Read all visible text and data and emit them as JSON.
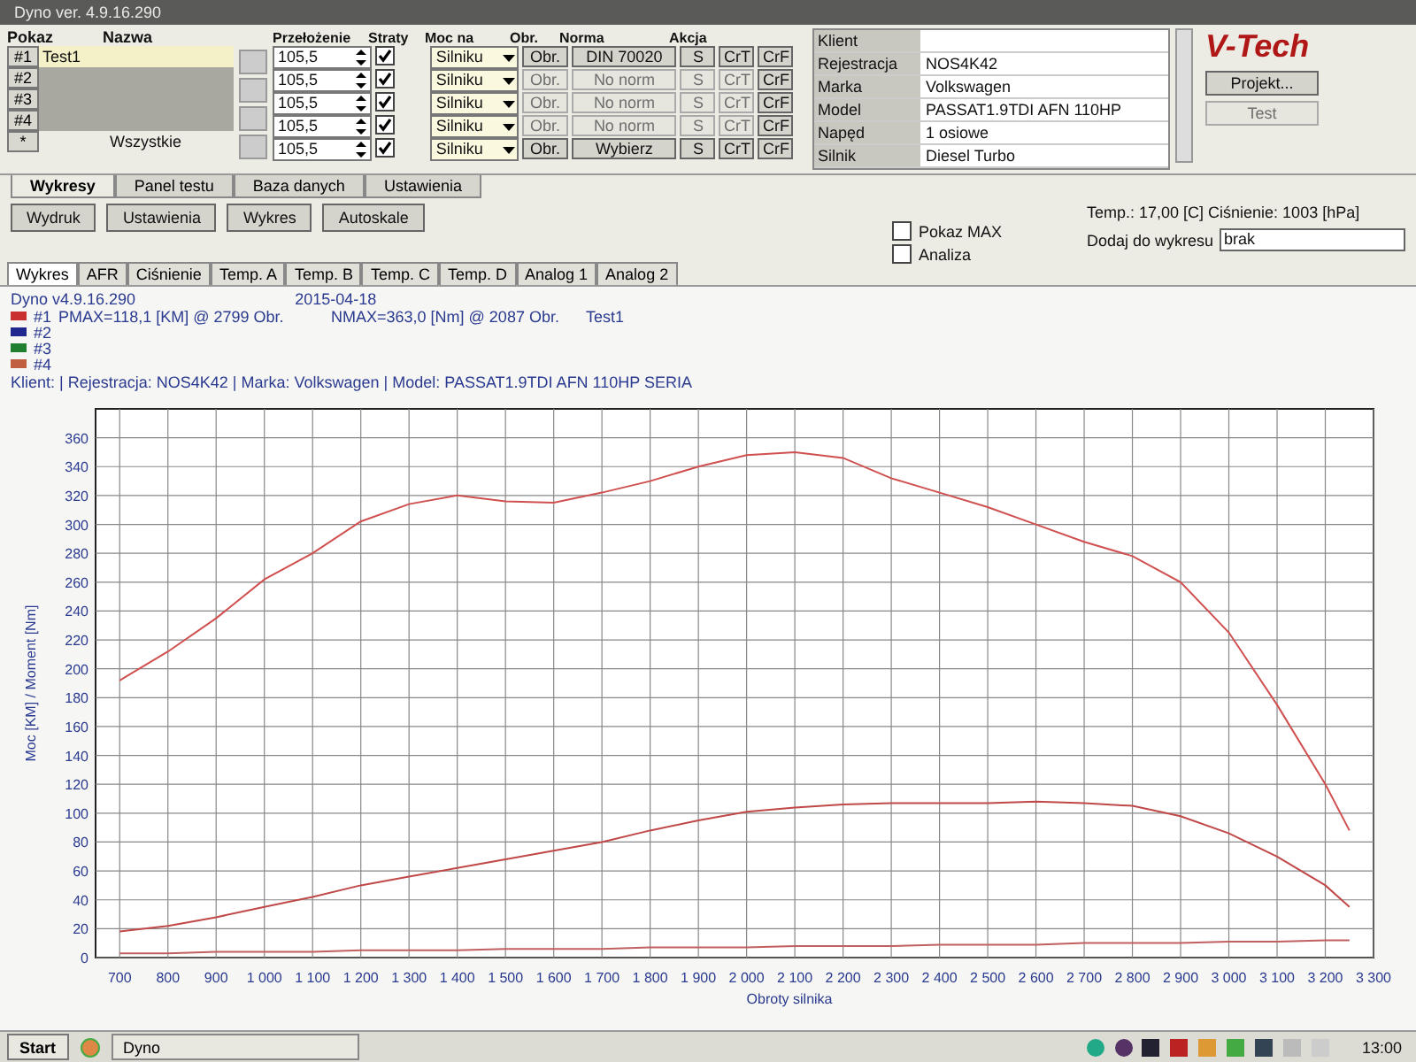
{
  "window": {
    "title": "Dyno ver. 4.9.16.290"
  },
  "tests": {
    "headers": [
      "Pokaz",
      "Nazwa"
    ],
    "rows": [
      {
        "label": "#1",
        "name": "Test1",
        "selected": true
      },
      {
        "label": "#2",
        "selected": false
      },
      {
        "label": "#3",
        "selected": false
      },
      {
        "label": "#4",
        "selected": false
      }
    ],
    "all_button": "*",
    "all_label": "Wszystkie"
  },
  "settings": {
    "headers": [
      "Przełożenie",
      "Straty",
      "Moc na",
      "Obr.",
      "Norma",
      "Akcja"
    ],
    "rows": [
      {
        "ratio": "105,5",
        "losses": true,
        "power_at": "Silniku",
        "rpm_button": "Obr.",
        "rpm_enabled": true,
        "norm": "DIN 70020",
        "norm_enabled": true,
        "actions": [
          {
            "label": "S",
            "enabled": true
          },
          {
            "label": "CrT",
            "enabled": true
          },
          {
            "label": "CrF",
            "enabled": true
          }
        ]
      },
      {
        "ratio": "105,5",
        "losses": true,
        "power_at": "Silniku",
        "rpm_button": "Obr.",
        "rpm_enabled": false,
        "norm": "No norm",
        "norm_enabled": false,
        "actions": [
          {
            "label": "S",
            "enabled": false
          },
          {
            "label": "CrT",
            "enabled": false
          },
          {
            "label": "CrF",
            "enabled": true
          }
        ]
      },
      {
        "ratio": "105,5",
        "losses": true,
        "power_at": "Silniku",
        "rpm_button": "Obr.",
        "rpm_enabled": false,
        "norm": "No norm",
        "norm_enabled": false,
        "actions": [
          {
            "label": "S",
            "enabled": false
          },
          {
            "label": "CrT",
            "enabled": false
          },
          {
            "label": "CrF",
            "enabled": true
          }
        ]
      },
      {
        "ratio": "105,5",
        "losses": true,
        "power_at": "Silniku",
        "rpm_button": "Obr.",
        "rpm_enabled": false,
        "norm": "No norm",
        "norm_enabled": false,
        "actions": [
          {
            "label": "S",
            "enabled": false
          },
          {
            "label": "CrT",
            "enabled": false
          },
          {
            "label": "CrF",
            "enabled": true
          }
        ]
      },
      {
        "ratio": "105,5",
        "losses": true,
        "power_at": "Silniku",
        "rpm_button": "Obr.",
        "rpm_enabled": true,
        "norm": "Wybierz",
        "norm_enabled": true,
        "actions": [
          {
            "label": "S",
            "enabled": true
          },
          {
            "label": "CrT",
            "enabled": true
          },
          {
            "label": "CrF",
            "enabled": true
          }
        ]
      }
    ]
  },
  "client": [
    {
      "label": "Klient"
    },
    {
      "label": "Rejestracja",
      "value": "NOS4K42"
    },
    {
      "label": "Marka",
      "value": "Volkswagen"
    },
    {
      "label": "Model",
      "value": "PASSAT1.9TDI AFN 110HP"
    },
    {
      "label": "Napęd",
      "value": "1 osiowe"
    },
    {
      "label": "Silnik",
      "value": "Diesel Turbo"
    }
  ],
  "logo": "V-Tech",
  "side_buttons": [
    {
      "label": "Projekt...",
      "enabled": true
    },
    {
      "label": "Test",
      "enabled": false
    }
  ],
  "main_tabs": [
    {
      "label": "Wykresy",
      "selected": true
    },
    {
      "label": "Panel testu",
      "selected": false
    },
    {
      "label": "Baza danych",
      "selected": false
    },
    {
      "label": "Ustawienia",
      "selected": false
    }
  ],
  "toolbar": [
    "Wydruk",
    "Ustawienia",
    "Wykres",
    "Autoskale"
  ],
  "conditions": "Temp.: 17,00 [C]  Ciśnienie: 1003 [hPa]",
  "options": [
    {
      "label": "Pokaz MAX",
      "checked": false
    },
    {
      "label": "Analiza",
      "checked": false
    }
  ],
  "add_to_chart": {
    "label": "Dodaj do wykresu",
    "value": "brak"
  },
  "chart_tabs": [
    {
      "label": "Wykres",
      "selected": true
    },
    {
      "label": "AFR",
      "selected": false
    },
    {
      "label": "Ciśnienie",
      "selected": false
    },
    {
      "label": "Temp. A",
      "selected": false
    },
    {
      "label": "Temp. B",
      "selected": false
    },
    {
      "label": "Temp. C",
      "selected": false
    },
    {
      "label": "Temp. D",
      "selected": false
    },
    {
      "label": "Analog 1",
      "selected": false
    },
    {
      "label": "Analog 2",
      "selected": false
    }
  ],
  "chart_header": {
    "version": "Dyno v4.9.16.290",
    "date": "2015-04-18",
    "legend": [
      {
        "label": "#1",
        "color": "#c83030",
        "pmax": "PMAX=118,1 [KM] @ 2799 Obr.",
        "nmax": "NMAX=363,0 [Nm] @ 2087 Obr.",
        "test": "Test1"
      },
      {
        "label": "#2",
        "color": "#202890"
      },
      {
        "label": "#3",
        "color": "#208030"
      },
      {
        "label": "#4",
        "color": "#c06040"
      }
    ],
    "client_line": "Klient:  | Rejestracja: NOS4K42 | Marka: Volkswagen | Model: PASSAT1.9TDI AFN 110HP SERIA"
  },
  "chart_data": {
    "type": "line",
    "xlabel": "Obroty silnika",
    "ylabel": "Moc [KM] / Moment [Nm]",
    "x": [
      700,
      800,
      900,
      1000,
      1100,
      1200,
      1300,
      1400,
      1500,
      1600,
      1700,
      1800,
      1900,
      2000,
      2100,
      2200,
      2300,
      2400,
      2500,
      2600,
      2700,
      2800,
      2900,
      3000,
      3100,
      3200,
      3250
    ],
    "grid": true,
    "series": [
      {
        "color": "#d05050",
        "values": [
          192,
          212,
          235,
          262,
          280,
          302,
          314,
          320,
          316,
          315,
          322,
          330,
          340,
          348,
          350,
          346,
          332,
          322,
          312,
          300,
          288,
          278,
          260,
          225,
          175,
          120,
          88
        ]
      },
      {
        "color": "#c04848",
        "values": [
          18,
          22,
          28,
          35,
          42,
          50,
          56,
          62,
          68,
          74,
          80,
          88,
          95,
          101,
          104,
          106,
          107,
          107,
          107,
          108,
          107,
          105,
          98,
          86,
          70,
          50,
          35
        ]
      },
      {
        "color": "#c06060",
        "values": [
          3,
          3,
          4,
          4,
          4,
          5,
          5,
          5,
          6,
          6,
          6,
          7,
          7,
          7,
          8,
          8,
          8,
          9,
          9,
          9,
          10,
          10,
          10,
          11,
          11,
          12,
          12
        ]
      }
    ],
    "xlim": [
      650,
      3300
    ],
    "ylim": [
      0,
      380
    ],
    "xticks": [
      700,
      800,
      900,
      {
        "value": 1000,
        "label": "1 000"
      },
      {
        "value": 1100,
        "label": "1 100"
      },
      {
        "value": 1200,
        "label": "1 200"
      },
      {
        "value": 1300,
        "label": "1 300"
      },
      {
        "value": 1400,
        "label": "1 400"
      },
      {
        "value": 1500,
        "label": "1 500"
      },
      {
        "value": 1600,
        "label": "1 600"
      },
      {
        "value": 1700,
        "label": "1 700"
      },
      {
        "value": 1800,
        "label": "1 800"
      },
      {
        "value": 1900,
        "label": "1 900"
      },
      {
        "value": 2000,
        "label": "2 000"
      },
      {
        "value": 2100,
        "label": "2 100"
      },
      {
        "value": 2200,
        "label": "2 200"
      },
      {
        "value": 2300,
        "label": "2 300"
      },
      {
        "value": 2400,
        "label": "2 400"
      },
      {
        "value": 2500,
        "label": "2 500"
      },
      {
        "value": 2600,
        "label": "2 600"
      },
      {
        "value": 2700,
        "label": "2 700"
      },
      {
        "value": 2800,
        "label": "2 800"
      },
      {
        "value": 2900,
        "label": "2 900"
      },
      {
        "value": 3000,
        "label": "3 000"
      },
      {
        "value": 3100,
        "label": "3 100"
      },
      {
        "value": 3200,
        "label": "3 200"
      },
      {
        "value": 3300,
        "label": "3 300"
      }
    ],
    "yticks": [
      0,
      20,
      40,
      60,
      80,
      100,
      120,
      140,
      160,
      180,
      200,
      220,
      240,
      260,
      280,
      300,
      320,
      340,
      360
    ]
  },
  "taskbar": {
    "start": "Start",
    "windows": [
      "Dyno"
    ],
    "clock": "13:00"
  }
}
